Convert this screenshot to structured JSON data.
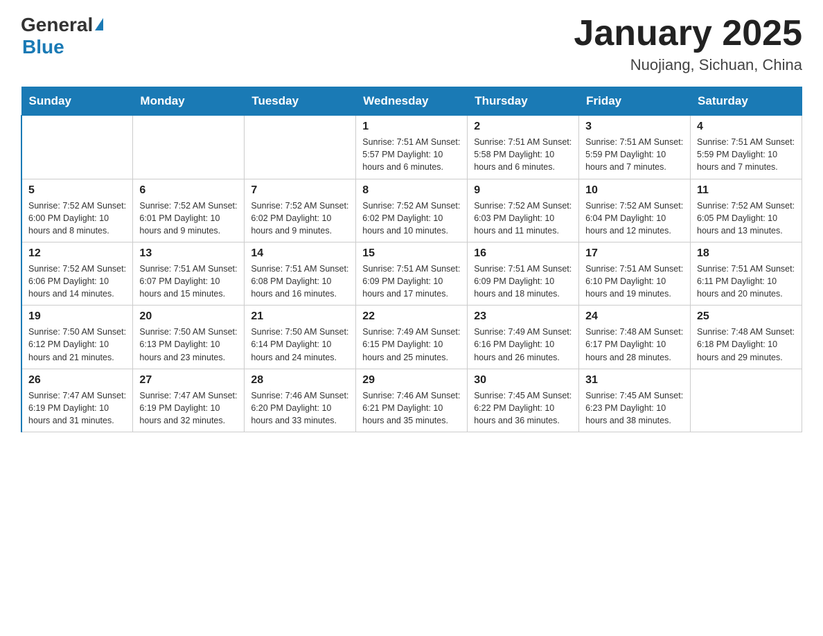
{
  "header": {
    "logo_general": "General",
    "logo_blue": "Blue",
    "month_title": "January 2025",
    "location": "Nuojiang, Sichuan, China"
  },
  "days_of_week": [
    "Sunday",
    "Monday",
    "Tuesday",
    "Wednesday",
    "Thursday",
    "Friday",
    "Saturday"
  ],
  "weeks": [
    [
      {
        "day": "",
        "info": ""
      },
      {
        "day": "",
        "info": ""
      },
      {
        "day": "",
        "info": ""
      },
      {
        "day": "1",
        "info": "Sunrise: 7:51 AM\nSunset: 5:57 PM\nDaylight: 10 hours and 6 minutes."
      },
      {
        "day": "2",
        "info": "Sunrise: 7:51 AM\nSunset: 5:58 PM\nDaylight: 10 hours and 6 minutes."
      },
      {
        "day": "3",
        "info": "Sunrise: 7:51 AM\nSunset: 5:59 PM\nDaylight: 10 hours and 7 minutes."
      },
      {
        "day": "4",
        "info": "Sunrise: 7:51 AM\nSunset: 5:59 PM\nDaylight: 10 hours and 7 minutes."
      }
    ],
    [
      {
        "day": "5",
        "info": "Sunrise: 7:52 AM\nSunset: 6:00 PM\nDaylight: 10 hours and 8 minutes."
      },
      {
        "day": "6",
        "info": "Sunrise: 7:52 AM\nSunset: 6:01 PM\nDaylight: 10 hours and 9 minutes."
      },
      {
        "day": "7",
        "info": "Sunrise: 7:52 AM\nSunset: 6:02 PM\nDaylight: 10 hours and 9 minutes."
      },
      {
        "day": "8",
        "info": "Sunrise: 7:52 AM\nSunset: 6:02 PM\nDaylight: 10 hours and 10 minutes."
      },
      {
        "day": "9",
        "info": "Sunrise: 7:52 AM\nSunset: 6:03 PM\nDaylight: 10 hours and 11 minutes."
      },
      {
        "day": "10",
        "info": "Sunrise: 7:52 AM\nSunset: 6:04 PM\nDaylight: 10 hours and 12 minutes."
      },
      {
        "day": "11",
        "info": "Sunrise: 7:52 AM\nSunset: 6:05 PM\nDaylight: 10 hours and 13 minutes."
      }
    ],
    [
      {
        "day": "12",
        "info": "Sunrise: 7:52 AM\nSunset: 6:06 PM\nDaylight: 10 hours and 14 minutes."
      },
      {
        "day": "13",
        "info": "Sunrise: 7:51 AM\nSunset: 6:07 PM\nDaylight: 10 hours and 15 minutes."
      },
      {
        "day": "14",
        "info": "Sunrise: 7:51 AM\nSunset: 6:08 PM\nDaylight: 10 hours and 16 minutes."
      },
      {
        "day": "15",
        "info": "Sunrise: 7:51 AM\nSunset: 6:09 PM\nDaylight: 10 hours and 17 minutes."
      },
      {
        "day": "16",
        "info": "Sunrise: 7:51 AM\nSunset: 6:09 PM\nDaylight: 10 hours and 18 minutes."
      },
      {
        "day": "17",
        "info": "Sunrise: 7:51 AM\nSunset: 6:10 PM\nDaylight: 10 hours and 19 minutes."
      },
      {
        "day": "18",
        "info": "Sunrise: 7:51 AM\nSunset: 6:11 PM\nDaylight: 10 hours and 20 minutes."
      }
    ],
    [
      {
        "day": "19",
        "info": "Sunrise: 7:50 AM\nSunset: 6:12 PM\nDaylight: 10 hours and 21 minutes."
      },
      {
        "day": "20",
        "info": "Sunrise: 7:50 AM\nSunset: 6:13 PM\nDaylight: 10 hours and 23 minutes."
      },
      {
        "day": "21",
        "info": "Sunrise: 7:50 AM\nSunset: 6:14 PM\nDaylight: 10 hours and 24 minutes."
      },
      {
        "day": "22",
        "info": "Sunrise: 7:49 AM\nSunset: 6:15 PM\nDaylight: 10 hours and 25 minutes."
      },
      {
        "day": "23",
        "info": "Sunrise: 7:49 AM\nSunset: 6:16 PM\nDaylight: 10 hours and 26 minutes."
      },
      {
        "day": "24",
        "info": "Sunrise: 7:48 AM\nSunset: 6:17 PM\nDaylight: 10 hours and 28 minutes."
      },
      {
        "day": "25",
        "info": "Sunrise: 7:48 AM\nSunset: 6:18 PM\nDaylight: 10 hours and 29 minutes."
      }
    ],
    [
      {
        "day": "26",
        "info": "Sunrise: 7:47 AM\nSunset: 6:19 PM\nDaylight: 10 hours and 31 minutes."
      },
      {
        "day": "27",
        "info": "Sunrise: 7:47 AM\nSunset: 6:19 PM\nDaylight: 10 hours and 32 minutes."
      },
      {
        "day": "28",
        "info": "Sunrise: 7:46 AM\nSunset: 6:20 PM\nDaylight: 10 hours and 33 minutes."
      },
      {
        "day": "29",
        "info": "Sunrise: 7:46 AM\nSunset: 6:21 PM\nDaylight: 10 hours and 35 minutes."
      },
      {
        "day": "30",
        "info": "Sunrise: 7:45 AM\nSunset: 6:22 PM\nDaylight: 10 hours and 36 minutes."
      },
      {
        "day": "31",
        "info": "Sunrise: 7:45 AM\nSunset: 6:23 PM\nDaylight: 10 hours and 38 minutes."
      },
      {
        "day": "",
        "info": ""
      }
    ]
  ]
}
